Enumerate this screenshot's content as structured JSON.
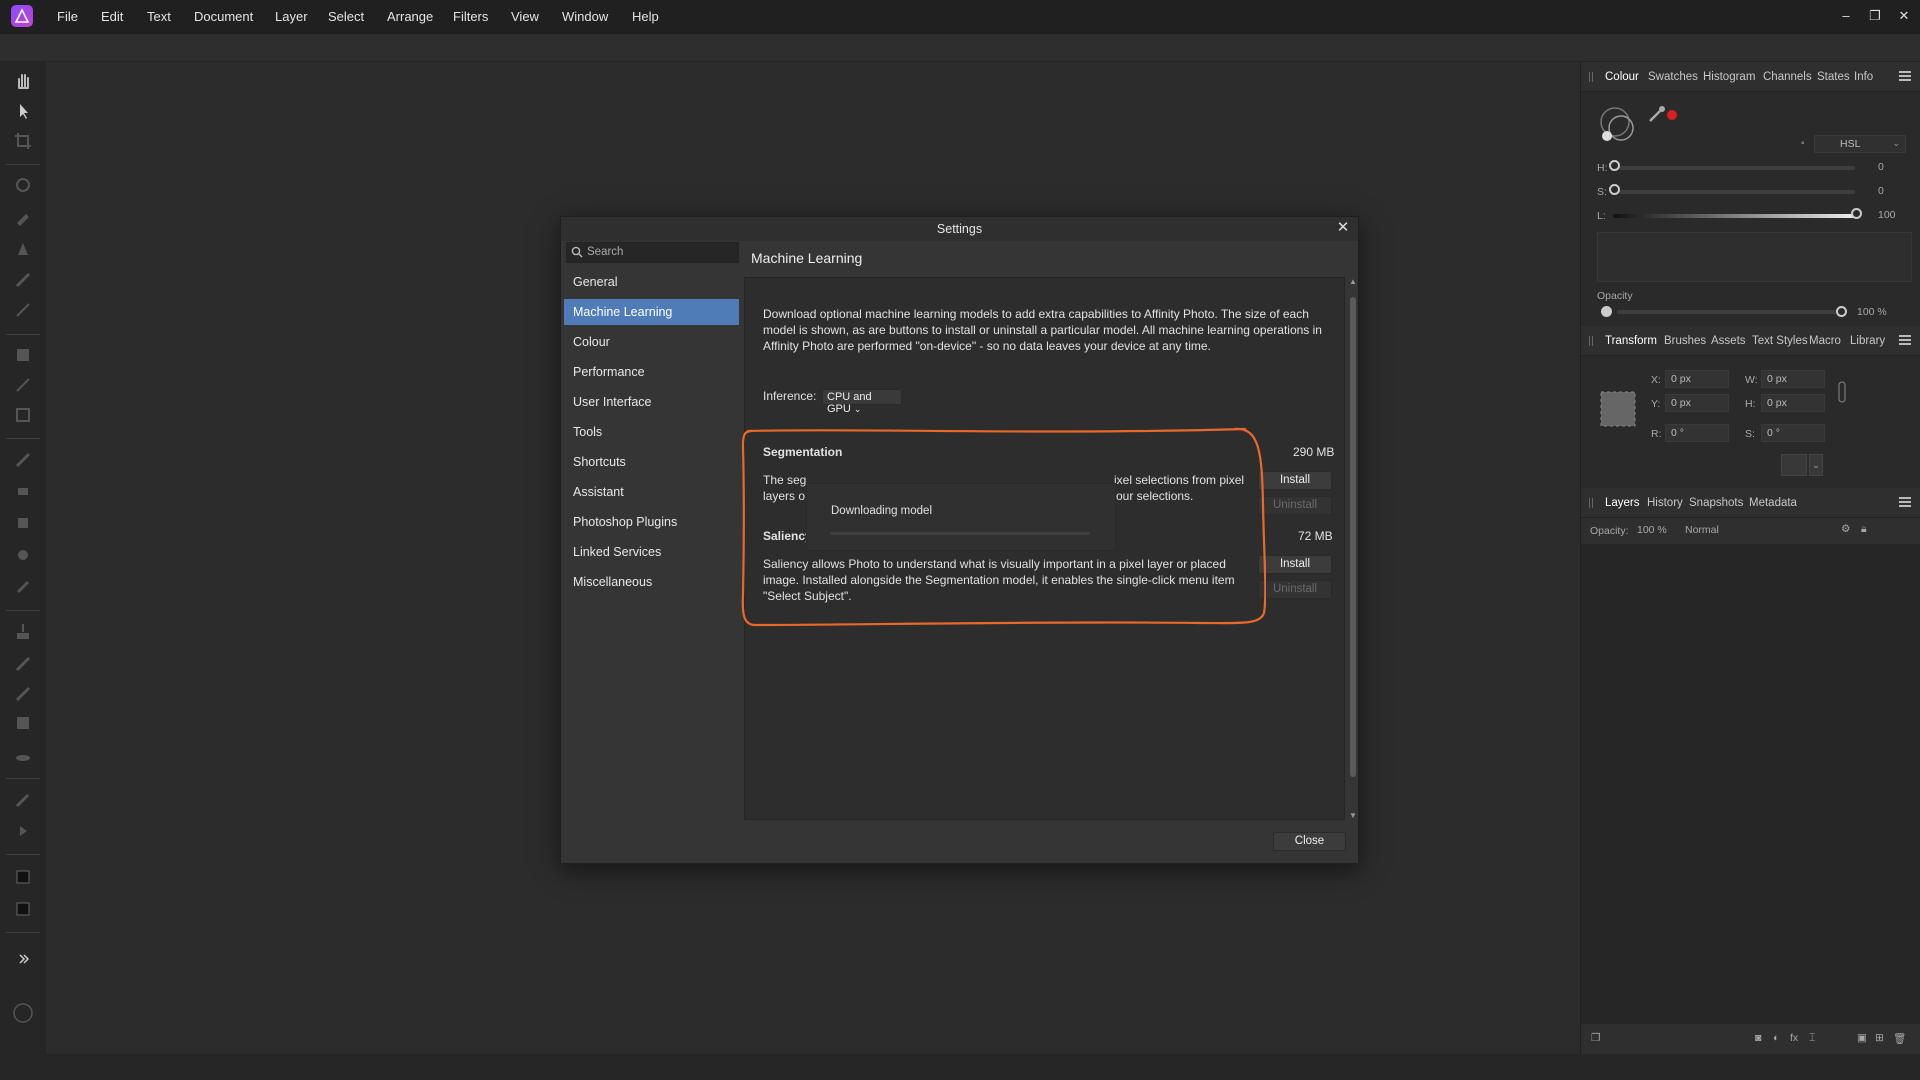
{
  "menu": [
    "File",
    "Edit",
    "Text",
    "Document",
    "Layer",
    "Select",
    "Arrange",
    "Filters",
    "View",
    "Window",
    "Help"
  ],
  "window_controls": {
    "minimize": "–",
    "restore": "❐",
    "close": "✕"
  },
  "right_panel": {
    "top_tabs": [
      "Colour",
      "Swatches",
      "Histogram",
      "Channels",
      "States",
      "Info"
    ],
    "colour": {
      "mode": "HSL",
      "h_label": "H:",
      "h_value": "0",
      "s_label": "S:",
      "s_value": "0",
      "l_label": "L:",
      "l_value": "100",
      "opacity_label": "Opacity",
      "opacity_value": "100 %"
    },
    "mid_tabs": [
      "Transform",
      "Brushes",
      "Assets",
      "Text Styles",
      "Macro",
      "Library"
    ],
    "transform": {
      "x_label": "X:",
      "x_value": "0 px",
      "w_label": "W:",
      "w_value": "0 px",
      "y_label": "Y:",
      "y_value": "0 px",
      "h_label": "H:",
      "h_value": "0 px",
      "r_label": "R:",
      "r_value": "0 °",
      "s_label": "S:",
      "s_value": "0 °"
    },
    "bottom_tabs": [
      "Layers",
      "History",
      "Snapshots",
      "Metadata"
    ],
    "layers": {
      "opacity_label": "Opacity:",
      "opacity_value": "100 %",
      "blend_mode": "Normal"
    }
  },
  "dialog": {
    "title": "Settings",
    "close_x": "✕",
    "search_placeholder": "Search",
    "nav": [
      "General",
      "Machine Learning",
      "Colour",
      "Performance",
      "User Interface",
      "Tools",
      "Shortcuts",
      "Assistant",
      "Photoshop Plugins",
      "Linked Services",
      "Miscellaneous"
    ],
    "active_nav": "Machine Learning",
    "section_title": "Machine Learning",
    "description": "Download optional machine learning models to add extra capabilities to Affinity Photo. The size of each model is shown, as are buttons to install or uninstall a particular model. All machine learning operations in Affinity Photo are performed \"on-device\" - so no data leaves your device at any time.",
    "inference_label": "Inference:",
    "inference_value": "CPU and GPU",
    "models": [
      {
        "name": "Segmentation",
        "size": "290 MB",
        "desc_part1": "The seg",
        "desc_part2": "ixel selections from pixel",
        "desc_line2a": "layers o",
        "desc_line2b": "our selections.",
        "install": "Install",
        "uninstall": "Uninstall"
      },
      {
        "name": "Saliency",
        "size": "72 MB",
        "description": "Saliency allows Photo to understand what is visually important in a pixel layer or placed image. Installed alongside the Segmentation model, it enables the single-click menu item \"Select Subject\".",
        "install": "Install",
        "uninstall": "Uninstall"
      }
    ],
    "progress": {
      "label": "Downloading model",
      "value": 0
    },
    "close_button": "Close"
  },
  "colors": {
    "accent": "#4f7bb7",
    "highlight": "#e8692a",
    "active_colour_swatch": "#d92020"
  }
}
